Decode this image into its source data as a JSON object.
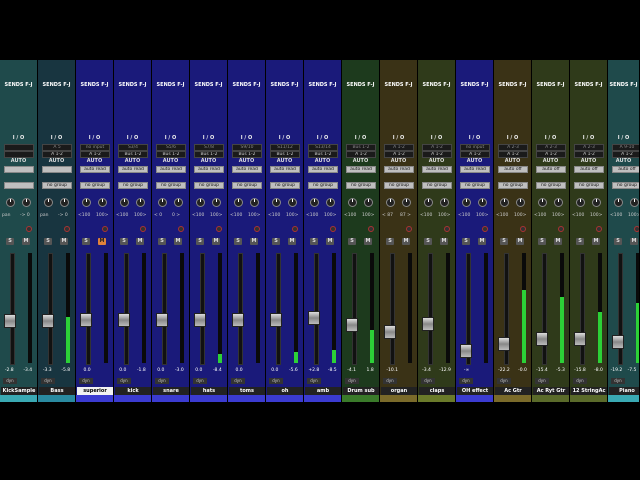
{
  "strips": [
    {
      "name": "KickSample",
      "sends": "SENDS F-J",
      "io": "I / O",
      "in": "",
      "out": "",
      "auto": "AUTO",
      "mode": "",
      "group": "",
      "pan_l": "pan",
      "pan_r": "-> 0",
      "vol": "-2.8",
      "peak": "-3.4",
      "fader_frac": 0.36,
      "meter_frac": 0.0,
      "bg": "#1f4a4b",
      "tint": "#3aa9b3",
      "mute_on": false,
      "selected": false
    },
    {
      "name": "Bass",
      "sends": "SENDS F-J",
      "io": "I / O",
      "in": "A 5",
      "out": "A 1-2",
      "auto": "AUTO",
      "mode": "",
      "group": "no group",
      "pan_l": "pan",
      "pan_r": "-> 0",
      "vol": "-3.3",
      "peak": "-5.8",
      "fader_frac": 0.36,
      "meter_frac": 0.42,
      "bg": "#183540",
      "tint": "#2a8aa0",
      "mute_on": false,
      "selected": false
    },
    {
      "name": "superior",
      "sends": "SENDS F-J",
      "io": "I / O",
      "in": "no input",
      "out": "A 1-2",
      "auto": "AUTO",
      "mode": "auto read",
      "group": "no group",
      "pan_l": "<100",
      "pan_r": "100>",
      "vol": "0.0",
      "peak": "",
      "fader_frac": 0.38,
      "meter_frac": 0.0,
      "bg": "#1a1a7a",
      "tint": "#3b3bd0",
      "mute_on": true,
      "selected": true
    },
    {
      "name": "kick",
      "sends": "SENDS F-J",
      "io": "I / O",
      "in": "S3/4",
      "out": "Bus 1-2",
      "auto": "AUTO",
      "mode": "auto read",
      "group": "no group",
      "pan_l": "<100",
      "pan_r": "100>",
      "vol": "0.0",
      "peak": "-1.8",
      "fader_frac": 0.38,
      "meter_frac": 0.0,
      "bg": "#1a1a7a",
      "tint": "#3b3bd0",
      "mute_on": false,
      "selected": false
    },
    {
      "name": "snare",
      "sends": "SENDS F-J",
      "io": "I / O",
      "in": "S5/6",
      "out": "Bus 1-2",
      "auto": "AUTO",
      "mode": "auto read",
      "group": "no group",
      "pan_l": "< 0",
      "pan_r": "0 >",
      "vol": "0.0",
      "peak": "-3.0",
      "fader_frac": 0.38,
      "meter_frac": 0.0,
      "bg": "#1a1a7a",
      "tint": "#3b3bd0",
      "mute_on": false,
      "selected": false
    },
    {
      "name": "hats",
      "sends": "SENDS F-J",
      "io": "I / O",
      "in": "S7/8",
      "out": "Bus 1-2",
      "auto": "AUTO",
      "mode": "auto read",
      "group": "no group",
      "pan_l": "<100",
      "pan_r": "100>",
      "vol": "0.0",
      "peak": "-8.4",
      "fader_frac": 0.38,
      "meter_frac": 0.08,
      "bg": "#1a1a7a",
      "tint": "#3b3bd0",
      "mute_on": false,
      "selected": false
    },
    {
      "name": "toms",
      "sends": "SENDS F-J",
      "io": "I / O",
      "in": "S9/10",
      "out": "Bus 1-2",
      "auto": "AUTO",
      "mode": "auto read",
      "group": "no group",
      "pan_l": "<100",
      "pan_r": "100>",
      "vol": "0.0",
      "peak": "",
      "fader_frac": 0.38,
      "meter_frac": 0.0,
      "bg": "#1a1a7a",
      "tint": "#3b3bd0",
      "mute_on": false,
      "selected": false
    },
    {
      "name": "oh",
      "sends": "SENDS F-J",
      "io": "I / O",
      "in": "S11/12",
      "out": "Bus 1-2",
      "auto": "AUTO",
      "mode": "auto read",
      "group": "no group",
      "pan_l": "<100",
      "pan_r": "100>",
      "vol": "0.0",
      "peak": "-5.6",
      "fader_frac": 0.38,
      "meter_frac": 0.1,
      "bg": "#1a1a7a",
      "tint": "#3b3bd0",
      "mute_on": false,
      "selected": false
    },
    {
      "name": "amb",
      "sends": "SENDS F-J",
      "io": "I / O",
      "in": "S13/14",
      "out": "Bus 1-2",
      "auto": "AUTO",
      "mode": "auto read",
      "group": "no group",
      "pan_l": "<100",
      "pan_r": "100>",
      "vol": "+2.8",
      "peak": "-8.5",
      "fader_frac": 0.4,
      "meter_frac": 0.12,
      "bg": "#1a1a7a",
      "tint": "#3b3bd0",
      "mute_on": false,
      "selected": false
    },
    {
      "name": "Drum sub",
      "sends": "SENDS F-J",
      "io": "I / O",
      "in": "Bus 1-2",
      "out": "A 1-2",
      "auto": "AUTO",
      "mode": "auto read",
      "group": "no group",
      "pan_l": "<100",
      "pan_r": "100>",
      "vol": "-4.1",
      "peak": "1.8",
      "fader_frac": 0.32,
      "meter_frac": 0.3,
      "bg": "#1d3a1d",
      "tint": "#3a7a2a",
      "mute_on": false,
      "selected": false
    },
    {
      "name": "organ",
      "sends": "SENDS F-J",
      "io": "I / O",
      "in": "A 1-2",
      "out": "A 1-2",
      "auto": "AUTO",
      "mode": "auto read",
      "group": "no group",
      "pan_l": "< 87",
      "pan_r": "87 >",
      "vol": "-10.1",
      "peak": "",
      "fader_frac": 0.25,
      "meter_frac": 0.0,
      "bg": "#3a3216",
      "tint": "#7a6a2a",
      "mute_on": false,
      "selected": false
    },
    {
      "name": "claps",
      "sends": "SENDS F-J",
      "io": "I / O",
      "in": "A 1-2",
      "out": "A 1-2",
      "auto": "AUTO",
      "mode": "auto read",
      "group": "no group",
      "pan_l": "<100",
      "pan_r": "100>",
      "vol": "-3.4",
      "peak": "-12.9",
      "fader_frac": 0.33,
      "meter_frac": 0.0,
      "bg": "#2f3a1a",
      "tint": "#6a7a2a",
      "mute_on": false,
      "selected": false
    },
    {
      "name": "OH effect",
      "sends": "SENDS F-J",
      "io": "I / O",
      "in": "no input",
      "out": "A 1-2",
      "auto": "AUTO",
      "mode": "auto read",
      "group": "no group",
      "pan_l": "<100",
      "pan_r": "100>",
      "vol": "-∞",
      "peak": "",
      "fader_frac": 0.05,
      "meter_frac": 0.0,
      "bg": "#1a1a7a",
      "tint": "#3b3bd0",
      "mute_on": false,
      "selected": false
    },
    {
      "name": "Ac Gtr",
      "sends": "SENDS F-J",
      "io": "I / O",
      "in": "A 2-3",
      "out": "A 1-2",
      "auto": "AUTO",
      "mode": "auto off",
      "group": "no group",
      "pan_l": "<100",
      "pan_r": "100>",
      "vol": "-22.2",
      "peak": "-0.0",
      "fader_frac": 0.12,
      "meter_frac": 0.66,
      "bg": "#3a3216",
      "tint": "#7a6a2a",
      "mute_on": false,
      "selected": false
    },
    {
      "name": "Ac Ryt Gtr",
      "sends": "SENDS F-J",
      "io": "I / O",
      "in": "A 2-3",
      "out": "A 1-2",
      "auto": "AUTO",
      "mode": "auto off",
      "group": "no group",
      "pan_l": "<100",
      "pan_r": "100>",
      "vol": "-15.4",
      "peak": "-5.3",
      "fader_frac": 0.18,
      "meter_frac": 0.6,
      "bg": "#2f3a1a",
      "tint": "#5a6a2a",
      "mute_on": false,
      "selected": false
    },
    {
      "name": "12 StringAc",
      "sends": "SENDS F-J",
      "io": "I / O",
      "in": "A 2-3",
      "out": "A 1-2",
      "auto": "AUTO",
      "mode": "auto off",
      "group": "no group",
      "pan_l": "<100",
      "pan_r": "100>",
      "vol": "-15.8",
      "peak": "-8.0",
      "fader_frac": 0.18,
      "meter_frac": 0.46,
      "bg": "#2f3a1a",
      "tint": "#5a6a2a",
      "mute_on": false,
      "selected": false
    },
    {
      "name": "Piano",
      "sends": "SENDS F-J",
      "io": "I / O",
      "in": "A 9-10",
      "out": "A 1-2",
      "auto": "AUTO",
      "mode": "auto off",
      "group": "no group",
      "pan_l": "<100",
      "pan_r": "100>",
      "vol": "-19.2",
      "peak": "-7.5",
      "fader_frac": 0.15,
      "meter_frac": 0.55,
      "bg": "#1f4a4b",
      "tint": "#3aa9b3",
      "mute_on": false,
      "selected": false
    }
  ],
  "labels": {
    "solo": "S",
    "mute": "M",
    "dyn": "dyn"
  }
}
